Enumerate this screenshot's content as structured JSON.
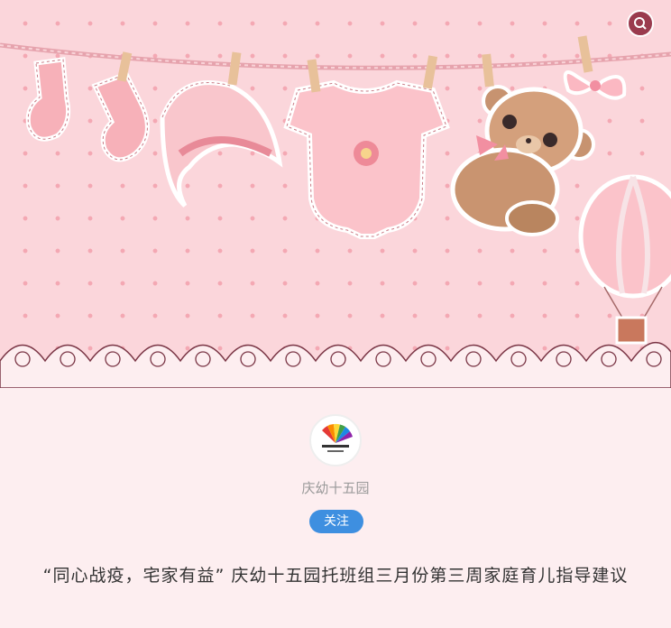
{
  "account": {
    "name": "庆幼十五园",
    "follow_label": "关注"
  },
  "article": {
    "title": "“同心战疫，宅家有益” 庆幼十五园托班组三月份第三周家庭育儿指导建议"
  },
  "colors": {
    "hero_bg": "#fbd6db",
    "dots": "#f4a8b3",
    "follow_button": "#3e8fe0",
    "accent": "#9a3b4e"
  },
  "icons": {
    "search": "search-icon",
    "avatar": "kindergarten-logo"
  }
}
